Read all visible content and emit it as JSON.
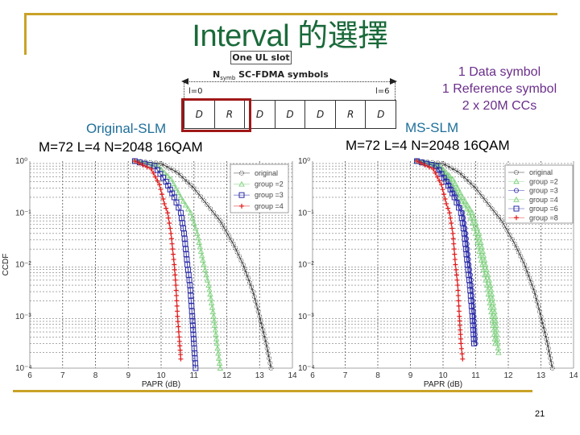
{
  "slide": {
    "title": "Interval 的選擇",
    "page_number": "21",
    "accent_color": "#c9a227",
    "title_color": "#1a6a3a"
  },
  "slot_diagram": {
    "header": "One UL slot",
    "nsymb_main": "N",
    "nsymb_sub": "symb",
    "nsymb_rest": " SC-FDMA symbols",
    "first_index": "l=0",
    "last_index": "l=6",
    "cells": [
      "D",
      "R",
      "D",
      "D",
      "D",
      "R",
      "D"
    ],
    "highlight_color": "#a01818"
  },
  "notes": {
    "line1": "1 Data symbol",
    "line2": "1 Reference symbol",
    "line3": "2 x 20M CCs",
    "color": "#6b2e8a"
  },
  "left_caption": {
    "method": "Original-SLM",
    "params": "M=72 L=4 N=2048 16QAM"
  },
  "right_caption": {
    "method": "MS-SLM",
    "params": "M=72 L=4 N=2048 16QAM"
  },
  "chart_data": [
    {
      "type": "line",
      "title": "Original-SLM M=72 L=4 N=2048 16QAM",
      "xlabel": "PAPR (dB)",
      "ylabel": "CCDF",
      "yscale": "log",
      "xlim": [
        6,
        14
      ],
      "ylim": [
        0.0001,
        1
      ],
      "xticks": [
        "6",
        "7",
        "8",
        "9",
        "10",
        "11",
        "12",
        "13",
        "14"
      ],
      "yticks": [
        "10^0",
        "10^-1",
        "10^-2",
        "10^-3",
        "10^-4"
      ],
      "grid": true,
      "legend_position": "top-right",
      "series": [
        {
          "name": "original",
          "color": "#222222",
          "marker": "circle-dotted",
          "x": [
            9.2,
            10.0,
            10.5,
            11.0,
            11.5,
            11.8,
            12.2,
            12.5,
            12.8,
            13.0,
            13.2,
            13.35
          ],
          "y": [
            1,
            0.9,
            0.6,
            0.3,
            0.12,
            0.07,
            0.025,
            0.01,
            0.003,
            0.001,
            0.0003,
            0.0001
          ]
        },
        {
          "name": "group =2",
          "color": "#7fd07f",
          "marker": "triangle",
          "x": [
            9.2,
            9.9,
            10.3,
            10.6,
            10.9,
            11.1,
            11.3,
            11.45,
            11.6,
            11.7,
            11.8
          ],
          "y": [
            1,
            0.8,
            0.45,
            0.2,
            0.1,
            0.04,
            0.01,
            0.004,
            0.001,
            0.0003,
            0.0001
          ]
        },
        {
          "name": "group =3",
          "color": "#2a2aa8",
          "marker": "square",
          "x": [
            9.2,
            9.8,
            10.15,
            10.4,
            10.6,
            10.7,
            10.8,
            10.88,
            10.95,
            11.0,
            11.05
          ],
          "y": [
            1,
            0.8,
            0.4,
            0.2,
            0.1,
            0.04,
            0.01,
            0.004,
            0.001,
            0.0003,
            0.0001
          ]
        },
        {
          "name": "group =4",
          "color": "#e01c1c",
          "marker": "plus",
          "x": [
            9.2,
            9.7,
            9.95,
            10.1,
            10.2,
            10.3,
            10.4,
            10.45,
            10.5,
            10.55,
            10.6
          ],
          "y": [
            1,
            0.7,
            0.35,
            0.15,
            0.1,
            0.04,
            0.01,
            0.004,
            0.001,
            0.0004,
            0.00015
          ]
        }
      ]
    },
    {
      "type": "line",
      "title": "MS-SLM M=72 L=4 N=2048 16QAM",
      "xlabel": "PAPR (dB)",
      "ylabel": "",
      "yscale": "log",
      "xlim": [
        6,
        14
      ],
      "ylim": [
        0.0001,
        1
      ],
      "xticks": [
        "6",
        "7",
        "8",
        "9",
        "10",
        "11",
        "12",
        "13",
        "14"
      ],
      "yticks": [
        "10^0",
        "10^-1",
        "10^-2",
        "10^-3",
        "10^-4"
      ],
      "grid": true,
      "legend_position": "top-right",
      "series": [
        {
          "name": "original",
          "color": "#222222",
          "marker": "circle-dotted",
          "x": [
            9.2,
            10.0,
            10.5,
            11.0,
            11.5,
            11.8,
            12.2,
            12.5,
            12.8,
            13.0,
            13.2,
            13.35
          ],
          "y": [
            1,
            0.9,
            0.6,
            0.3,
            0.12,
            0.07,
            0.025,
            0.01,
            0.003,
            0.001,
            0.0003,
            0.0001
          ]
        },
        {
          "name": "group =2",
          "color": "#7fd07f",
          "marker": "triangle",
          "x": [
            9.2,
            9.9,
            10.3,
            10.6,
            10.9,
            11.1,
            11.3,
            11.45,
            11.6,
            11.7
          ],
          "y": [
            1,
            0.8,
            0.45,
            0.2,
            0.1,
            0.04,
            0.01,
            0.004,
            0.001,
            0.0002
          ]
        },
        {
          "name": "group =3",
          "color": "#2a2aa8",
          "marker": "circle",
          "x": [
            9.2,
            9.8,
            10.15,
            10.4,
            10.6,
            10.7,
            10.8,
            10.88,
            10.95,
            11.0
          ],
          "y": [
            1,
            0.8,
            0.4,
            0.2,
            0.1,
            0.04,
            0.01,
            0.004,
            0.001,
            0.0003
          ]
        },
        {
          "name": "group =4",
          "color": "#7fd07f",
          "marker": "triangle",
          "x": [
            9.2,
            9.85,
            10.2,
            10.5,
            10.8,
            11.0,
            11.2,
            11.35,
            11.5,
            11.6
          ],
          "y": [
            1,
            0.8,
            0.45,
            0.2,
            0.1,
            0.04,
            0.01,
            0.004,
            0.001,
            0.0003
          ]
        },
        {
          "name": "group =6",
          "color": "#2a2aa8",
          "marker": "square",
          "x": [
            9.2,
            9.8,
            10.1,
            10.35,
            10.55,
            10.65,
            10.75,
            10.82,
            10.9,
            10.95
          ],
          "y": [
            1,
            0.8,
            0.4,
            0.2,
            0.1,
            0.04,
            0.01,
            0.004,
            0.001,
            0.0003
          ]
        },
        {
          "name": "group =8",
          "color": "#e01c1c",
          "marker": "plus",
          "x": [
            9.2,
            9.7,
            9.95,
            10.1,
            10.2,
            10.3,
            10.38,
            10.45,
            10.5,
            10.55,
            10.6
          ],
          "y": [
            1,
            0.7,
            0.35,
            0.15,
            0.1,
            0.04,
            0.01,
            0.004,
            0.001,
            0.0003,
            0.00015
          ]
        }
      ]
    }
  ]
}
